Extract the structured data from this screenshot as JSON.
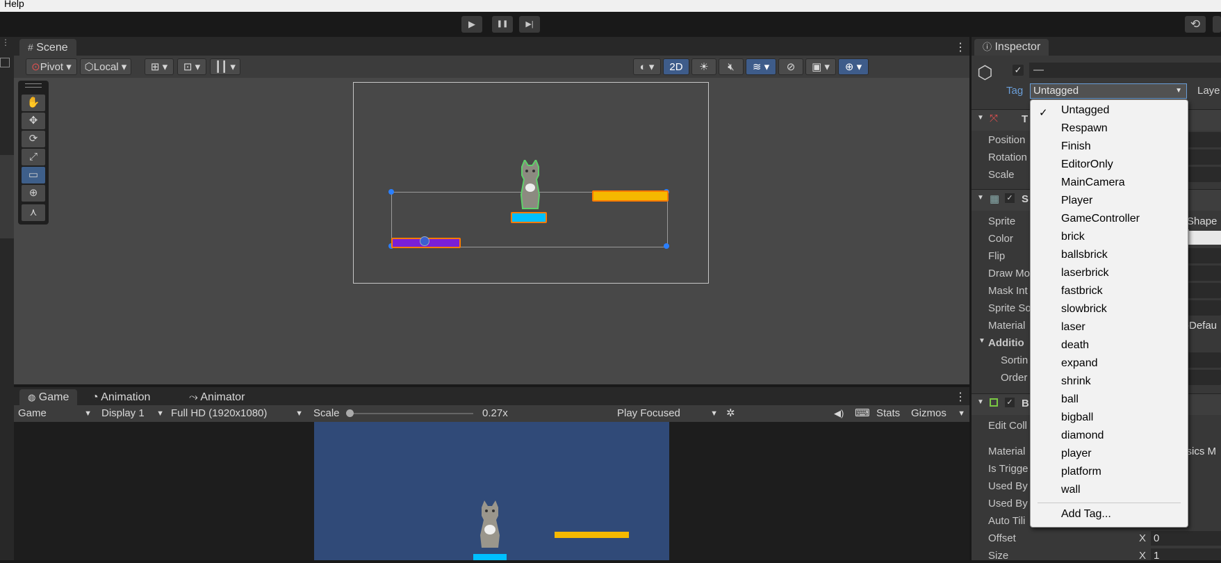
{
  "menu": {
    "help": "Help"
  },
  "playbar": {
    "play": "▶",
    "pause": "❚❚",
    "step": "▶|",
    "history": "⟲"
  },
  "scene": {
    "tab": "Scene",
    "pivot": "Pivot",
    "local": "Local",
    "mode2d": "2D",
    "tools": [
      "✋",
      "✥",
      "⟳",
      "⤢",
      "▭",
      "⊕",
      "⋏"
    ]
  },
  "game": {
    "tabs": [
      "Game",
      "Animation",
      "Animator"
    ],
    "view": "Game",
    "display": "Display 1",
    "resolution": "Full HD (1920x1080)",
    "scale_label": "Scale",
    "scale_value": "0.27x",
    "play_mode": "Play Focused",
    "stats": "Stats",
    "gizmos": "Gizmos"
  },
  "inspector": {
    "tab": "Inspector",
    "name_value": "—",
    "tag_label": "Tag",
    "tag_value": "Untagged",
    "layer_label": "Laye",
    "transform_header": "T",
    "transform_fields": [
      "Position",
      "Rotation",
      "Scale"
    ],
    "sprite_header": "S",
    "sprite_fields": [
      "Sprite",
      "Color",
      "Flip",
      "Draw Mo",
      "Mask Int",
      "Sprite So",
      "Material"
    ],
    "sprite_value": "Shape I",
    "material_value": "-Defau",
    "additional": "Additio",
    "additional_fields": [
      "Sortin",
      "Order"
    ],
    "box_header": "B",
    "box_fields": [
      "Edit Coll",
      "Material",
      "Is Trigge",
      "Used By",
      "Used By",
      "Auto Tili",
      "Offset",
      "Size"
    ],
    "physics_value": "ysics M",
    "offset_axis": "X",
    "offset_value": "0",
    "size_axis": "X",
    "size_value": "1"
  },
  "tag_dropdown": {
    "selected": "Untagged",
    "check": "✓",
    "items": [
      "Untagged",
      "Respawn",
      "Finish",
      "EditorOnly",
      "MainCamera",
      "Player",
      "GameController",
      "brick",
      "ballsbrick",
      "laserbrick",
      "fastbrick",
      "slowbrick",
      "laser",
      "death",
      "expand",
      "shrink",
      "ball",
      "bigball",
      "diamond",
      "player",
      "platform",
      "wall"
    ],
    "add": "Add Tag..."
  },
  "colors": {
    "accent": "#3e5f8a",
    "game_bg": "#304a78",
    "paddle_yellow": "#f5b800",
    "paddle_purple": "#7a1fd6",
    "brick_cyan": "#00bfff",
    "outline": "#ff7a00"
  }
}
